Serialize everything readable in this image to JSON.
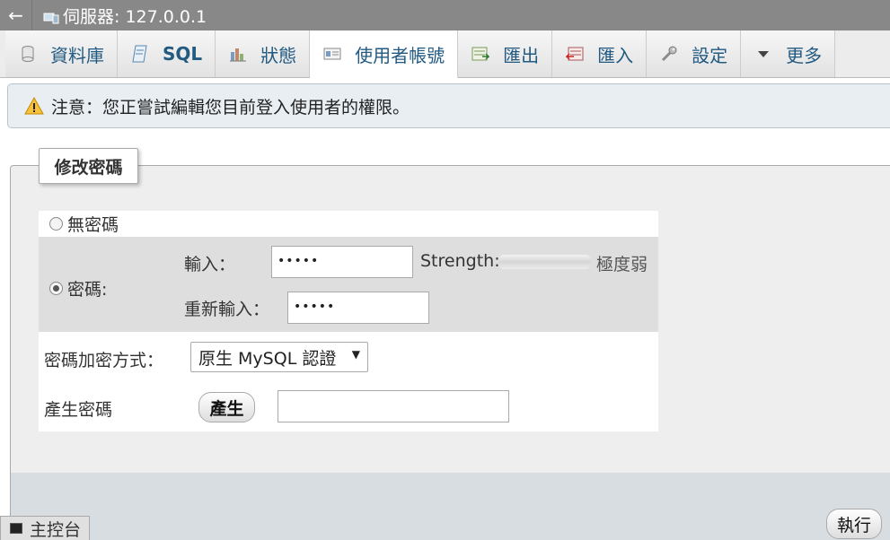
{
  "server": {
    "label": "伺服器: 127.0.0.1"
  },
  "tabs": [
    {
      "label": "資料庫",
      "icon": "database-icon"
    },
    {
      "label": "SQL",
      "icon": "sql-icon"
    },
    {
      "label": "狀態",
      "icon": "status-icon"
    },
    {
      "label": "使用者帳號",
      "icon": "user-accounts-icon",
      "active": true
    },
    {
      "label": "匯出",
      "icon": "export-icon"
    },
    {
      "label": "匯入",
      "icon": "import-icon"
    },
    {
      "label": "設定",
      "icon": "wrench-icon"
    },
    {
      "label": "更多",
      "icon": "chevron-down-icon"
    }
  ],
  "notice": {
    "text": "注意：您正嘗試編輯您目前登入使用者的權限。"
  },
  "change_password": {
    "legend": "修改密碼",
    "no_password_label": "無密碼",
    "password_label": "密碼:",
    "enter_label": "輸入：",
    "enter_value": "•••••",
    "strength_label": "Strength:",
    "strength_value": "極度弱",
    "reenter_label": "重新輸入：",
    "reenter_value": "•••••",
    "hashing_label": "密碼加密方式：",
    "hashing_value": "原生 MySQL 認證",
    "generate_label": "產生密碼",
    "generate_button": "產生"
  },
  "go_button": "執行",
  "console": {
    "label": "主控台"
  },
  "colors": {
    "tab_text": "#235a81",
    "topbar": "#888888",
    "notice_bg": "#e9eef2",
    "panel_bg": "#eeeeee"
  }
}
